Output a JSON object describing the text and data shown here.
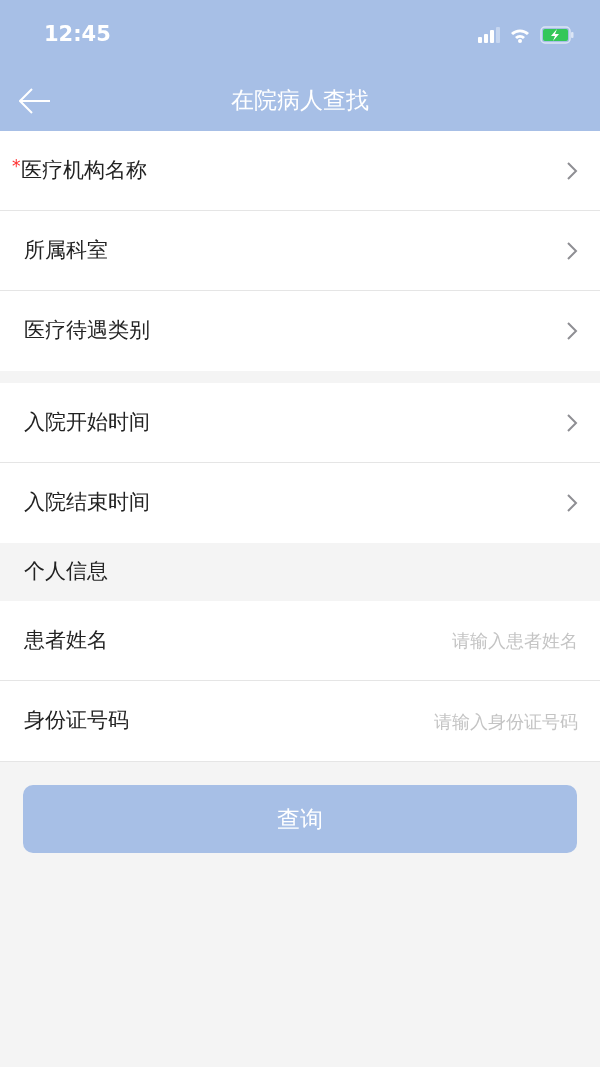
{
  "status_bar": {
    "time": "12:45"
  },
  "nav": {
    "title": "在院病人查找"
  },
  "groups": [
    {
      "items": [
        {
          "label": "医疗机构名称",
          "marker": "*"
        },
        {
          "label": "所属科室"
        },
        {
          "label": "医疗待遇类别"
        }
      ]
    },
    {
      "items": [
        {
          "label": "入院开始时间"
        },
        {
          "label": "入院结束时间"
        }
      ]
    }
  ],
  "personal_section": {
    "heading": "个人信息",
    "fields": [
      {
        "label": "患者姓名",
        "placeholder": "请输入患者姓名"
      },
      {
        "label": "身份证号码",
        "placeholder": "请输入身份证号码"
      }
    ]
  },
  "query_button": {
    "label": "查询",
    "disabled": true
  }
}
